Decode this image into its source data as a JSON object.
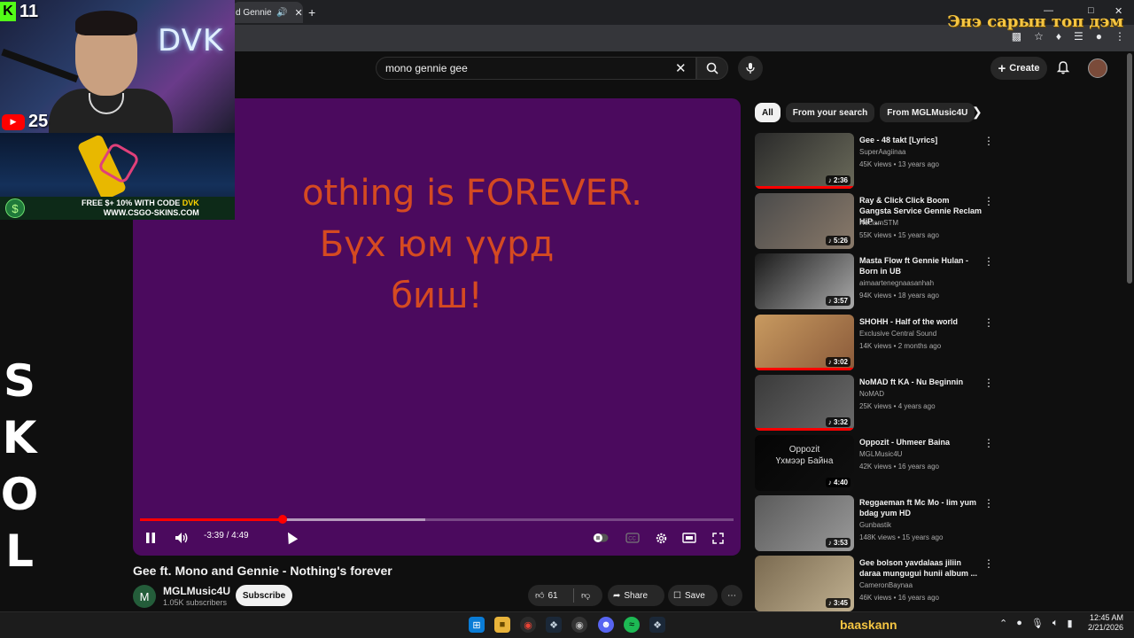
{
  "browser": {
    "tab_title": "d Gennie -",
    "overlay_text": "Энэ сарын топ дэм"
  },
  "header": {
    "search_value": "mono gennie gee",
    "create_label": "Create"
  },
  "stream_overlay": {
    "kick_count": "11",
    "youtube_count": "25",
    "streamer_logo": "DVK",
    "ad_line1": "FREE $",
    "ad_line1_tail": "+ 10% WITH CODE ",
    "ad_code": "DVK",
    "ad_url": "WWW.CSGO-SKINS.COM",
    "side_glyphs": [
      "S",
      "K",
      "O",
      "L"
    ],
    "streamer_name": "baaskann"
  },
  "player": {
    "lyrics": [
      "othing is FOREVER.",
      "Бүх юм үүрд",
      "биш!"
    ],
    "time_display": "-3:39 / 4:49",
    "progress_fraction": 0.24,
    "buffer_fraction": 0.48,
    "progress_color": "#ff0000",
    "background_color": "#4b0a5e",
    "lyric_color": "#e1501c"
  },
  "video": {
    "title": "Gee ft. Mono and Gennie - Nothing's forever",
    "channel_initial": "M",
    "channel_name": "MGLMusic4U",
    "subscribers": "1.05K subscribers",
    "subscribe_label": "Subscribe",
    "like_count": "61",
    "share_label": "Share",
    "save_label": "Save"
  },
  "chips": [
    "All",
    "From your search",
    "From MGLMusic4U"
  ],
  "recommendations": [
    {
      "title": "Gee - 48 takt [Lyrics]",
      "channel": "SuperAagiinaa",
      "meta": "45K views • 13 years ago",
      "duration": "2:36",
      "watched": 1.0
    },
    {
      "title": "Ray & Click Click Boom Gangsta Service Gennie Reclam   HiP ...",
      "channel": "ReclamSTM",
      "meta": "55K views • 15 years ago",
      "duration": "5:26",
      "watched": 0
    },
    {
      "title": "Masta Flow ft Gennie Hulan - Born in UB",
      "channel": "aimaartenegnaasanhah",
      "meta": "94K views • 18 years ago",
      "duration": "3:57",
      "watched": 0
    },
    {
      "title": "SHOHH - Half of the world",
      "channel": "Exclusive Central Sound",
      "meta": "14K views • 2 months ago",
      "duration": "3:02",
      "watched": 1.0
    },
    {
      "title": "NoMAD ft KA - Nu Beginnin",
      "channel": "NoMAD",
      "meta": "25K views • 4 years ago",
      "duration": "3:32",
      "watched": 1.0
    },
    {
      "title": "Oppozit - Uhmeer Baina",
      "channel": "MGLMusic4U",
      "meta": "42K views • 16 years ago",
      "duration": "4:40",
      "watched": 0,
      "thumb_text": "Oppozit\nҮхмээр Байна"
    },
    {
      "title": "Reggaeman ft Mc Mo - lim yum bdag yum HD",
      "channel": "Gunbastik",
      "meta": "148K views • 15 years ago",
      "duration": "3:53",
      "watched": 0
    },
    {
      "title": "Gee bolson yavdalaas jiliin daraa mungugui hunii album ...",
      "channel": "CameronBaynaa",
      "meta": "46K views • 16 years ago",
      "duration": "3:45",
      "watched": 0
    }
  ],
  "taskbar": {
    "time": "12:45 AM",
    "date": "2/21/2026"
  }
}
